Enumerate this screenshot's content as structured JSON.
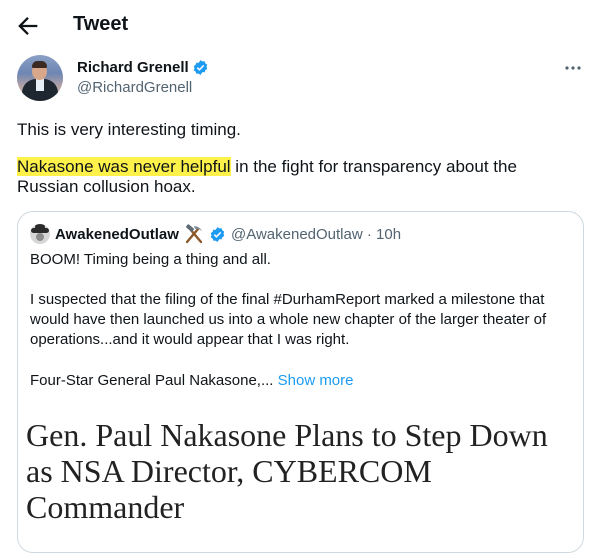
{
  "header": {
    "title": "Tweet",
    "back_icon": "arrow-left-icon"
  },
  "tweet": {
    "author_name": "Richard Grenell",
    "author_handle": "@RichardGrenell",
    "line1": "This is very interesting timing.",
    "highlighted_text": "Nakasone was never helpful",
    "rest_text": " in the fight for transparency about the Russian collusion hoax."
  },
  "quote": {
    "author_name": "AwakenedOutlaw",
    "author_emoji": "hammer-and-pick",
    "meta": "@AwakenedOutlaw · 10h",
    "line1": "BOOM!  Timing being a thing and all.",
    "para2": "I suspected that the filing of the final #DurhamReport marked a milestone that would have then launched us into a whole new chapter of the larger theater of operations...and it would appear that I was right.",
    "para3": "Four-Star General Paul Nakasone,...",
    "show_more": "Show more",
    "headline": "Gen. Paul Nakasone Plans to Step Down as NSA Director, CYBERCOM Commander"
  },
  "colors": {
    "accent": "#1d9bf0",
    "highlight": "#fdf14a",
    "muted": "#536471",
    "border": "#cfd9de"
  }
}
